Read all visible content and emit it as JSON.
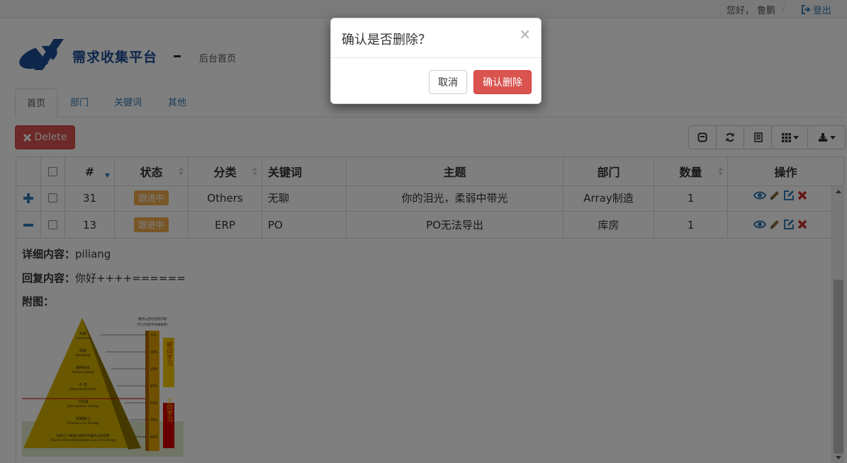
{
  "topbar": {
    "greeting": "您好，",
    "username": "鲁鹏",
    "separator": "/",
    "logout_label": "登出"
  },
  "header": {
    "brand": "需求收集平台",
    "subtitle": "后台首页"
  },
  "tabs": [
    {
      "label": "首页"
    },
    {
      "label": "部门"
    },
    {
      "label": "关键词"
    },
    {
      "label": "其他"
    }
  ],
  "toolbar": {
    "delete_label": "Delete"
  },
  "table": {
    "headers": [
      "#",
      "状态",
      "分类",
      "关键词",
      "主题",
      "部门",
      "数量",
      "操作"
    ],
    "rows": [
      {
        "expand": "+",
        "id": "31",
        "status": "跟进中",
        "category": "Others",
        "keyword": "无聊",
        "subject": "你的泪光，柔弱中带光",
        "dept": "Array制造",
        "qty": "1"
      },
      {
        "expand": "−",
        "id": "13",
        "status": "跟进中",
        "category": "ERP",
        "keyword": "PO",
        "subject": "PO无法导出",
        "dept": "库房",
        "qty": "1"
      }
    ]
  },
  "detail": {
    "content_label": "详细内容：",
    "content_value": "piliang",
    "reply_label": "回复内容：",
    "reply_value": "你好++++======",
    "image_label": "附图："
  },
  "pyramid": {
    "title_top": "两周以后记住的内容",
    "title_sub": "（学习内容平均保留率）",
    "levels": [
      {
        "cn": "听讲",
        "en": "Lecture",
        "pct": "5%"
      },
      {
        "cn": "阅读",
        "en": "Reading",
        "pct": "10%"
      },
      {
        "cn": "视听结合",
        "en": "Audio-visual",
        "pct": "20%"
      },
      {
        "cn": "示 范",
        "en": "Demonstration",
        "pct": "30%"
      },
      {
        "cn": "讨论组",
        "en": "Discussion Group",
        "pct": "50%"
      },
      {
        "cn": "实践练习",
        "en": "Practice by Doing",
        "pct": "75%"
      },
      {
        "cn": "向其它人教授/对所学内容的立即应用",
        "en": "Teach others/immediate use of learning",
        "pct": "90%"
      }
    ],
    "passive_label": "被动学习",
    "active_label": "主动学习"
  },
  "modal": {
    "title": "确认是否删除？",
    "close": "×",
    "cancel_label": "取消",
    "confirm_label": "确认删除"
  }
}
